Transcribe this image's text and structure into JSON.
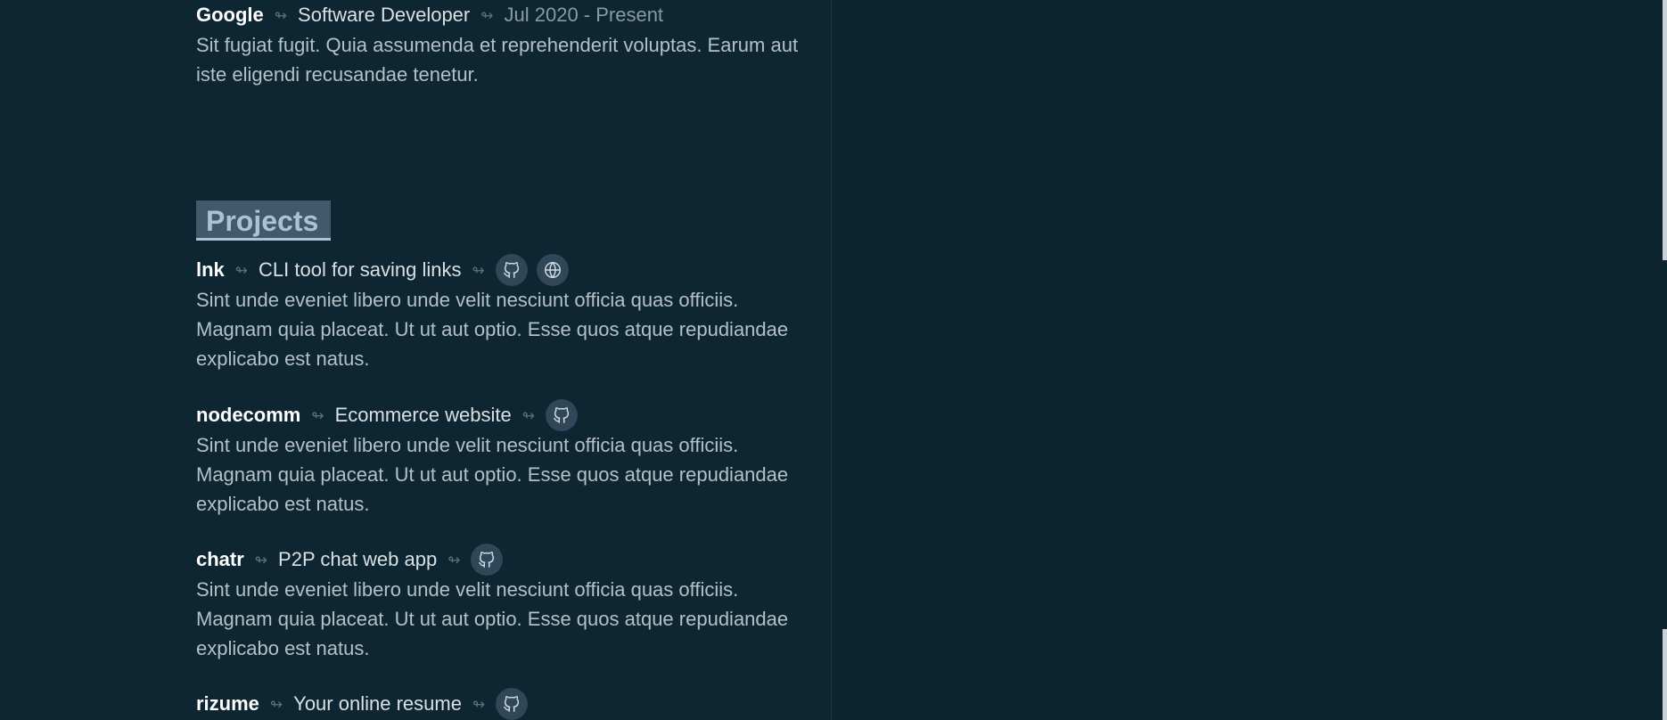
{
  "experience": {
    "company": "Google",
    "role": "Software Developer",
    "date": "Jul 2020 - Present",
    "description": "Sit fugiat fugit. Quia assumenda et reprehenderit voluptas. Earum aut iste eligendi recusandae tenetur."
  },
  "projects": {
    "title": "Projects",
    "items": [
      {
        "name": "lnk",
        "tagline": "CLI tool for saving links",
        "description": "Sint unde eveniet libero unde velit nesciunt officia quas officiis. Magnam quia placeat. Ut ut aut optio. Esse quos atque repudiandae explicabo est natus.",
        "links": [
          "github-icon",
          "globe-icon"
        ]
      },
      {
        "name": "nodecomm",
        "tagline": "Ecommerce website",
        "description": "Sint unde eveniet libero unde velit nesciunt officia quas officiis. Magnam quia placeat. Ut ut aut optio. Esse quos atque repudiandae explicabo est natus.",
        "links": [
          "github-icon"
        ]
      },
      {
        "name": "chatr",
        "tagline": "P2P chat web app",
        "description": "Sint unde eveniet libero unde velit nesciunt officia quas officiis. Magnam quia placeat. Ut ut aut optio. Esse quos atque repudiandae explicabo est natus.",
        "links": [
          "github-icon"
        ]
      },
      {
        "name": "rizume",
        "tagline": "Your online resume",
        "links": [
          "github-icon"
        ]
      }
    ]
  },
  "separator_glyph": "↬",
  "colors": {
    "background": "#0e2631",
    "heading_bg": "#41596a",
    "heading_text": "#a9c2d6",
    "icon_bg": "#2f4758"
  }
}
